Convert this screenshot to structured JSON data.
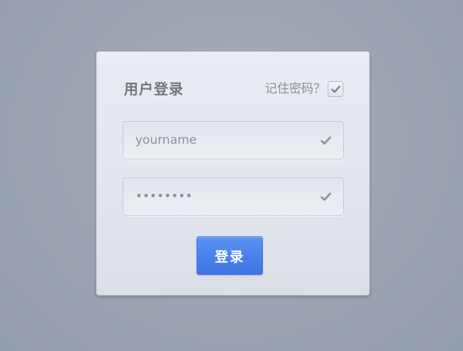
{
  "login_panel": {
    "title": "用户登录",
    "remember": {
      "label": "记住密码？",
      "checked": true,
      "icon": "check-icon"
    },
    "username": {
      "placeholder": "yourname",
      "value": "",
      "icon": "check-icon"
    },
    "password": {
      "value": "••••••••",
      "icon": "check-icon"
    },
    "submit_label": "登录"
  },
  "colors": {
    "background": "#9aa3af",
    "panel": "#e4e8ef",
    "button": "#4a80ea",
    "button_text": "#ffffff",
    "text": "#707784",
    "icon": "#8e939c"
  }
}
